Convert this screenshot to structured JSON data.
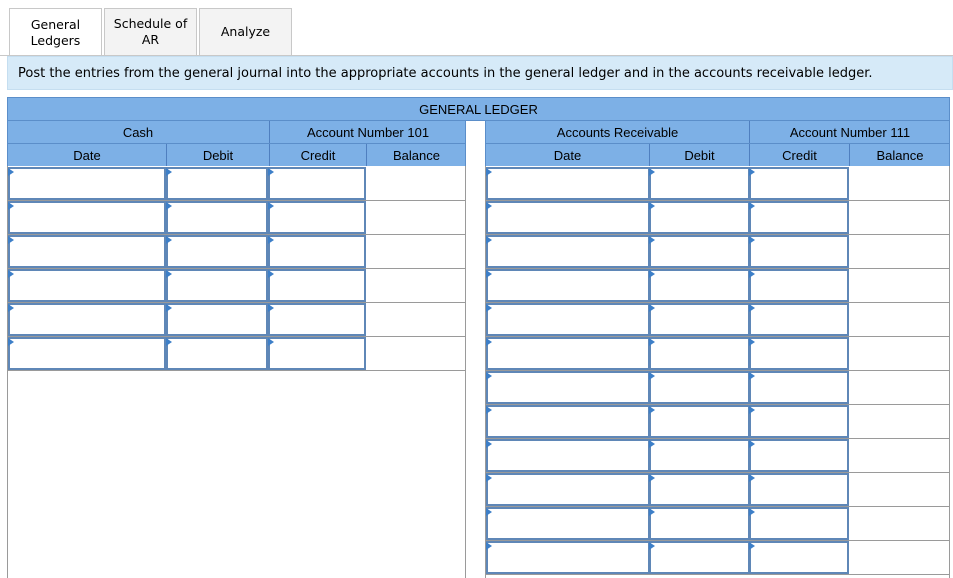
{
  "tabs": [
    {
      "label": "General\nLedgers",
      "active": true
    },
    {
      "label": "Schedule of\nAR",
      "active": false
    },
    {
      "label": "Analyze",
      "active": false
    }
  ],
  "instruction": "Post the entries from the general journal into the appropriate accounts in the general ledger and in the accounts receivable ledger.",
  "ledger": {
    "title": "GENERAL LEDGER",
    "accounts": [
      {
        "name": "Cash",
        "number_label": "Account Number 101",
        "columns": [
          "Date",
          "Debit",
          "Credit",
          "Balance"
        ],
        "row_count": 6
      },
      {
        "name": "Accounts Receivable",
        "number_label": "Account Number 111",
        "columns": [
          "Date",
          "Debit",
          "Credit",
          "Balance"
        ],
        "row_count": 12
      }
    ]
  },
  "colors": {
    "header_blue": "#7db0e6",
    "instruction_bg": "#d6eaf8",
    "input_border": "#5f87b7"
  }
}
